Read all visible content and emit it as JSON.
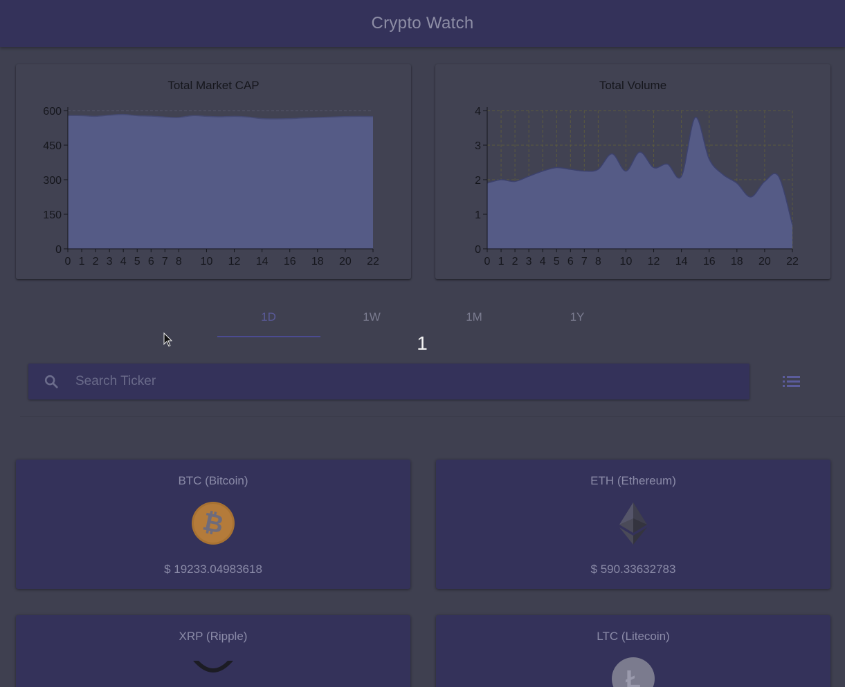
{
  "app": {
    "title": "Crypto Watch"
  },
  "chart_data": [
    {
      "type": "area",
      "title": "Total Market CAP",
      "x": [
        0,
        1,
        2,
        3,
        4,
        5,
        6,
        7,
        8,
        9,
        10,
        11,
        12,
        13,
        14,
        15,
        16,
        17,
        18,
        19,
        20,
        21,
        22
      ],
      "y": [
        578,
        578,
        575,
        580,
        583,
        578,
        576,
        572,
        570,
        578,
        575,
        573,
        575,
        572,
        565,
        564,
        565,
        568,
        570,
        572,
        574,
        575,
        574
      ],
      "xticks": [
        0,
        1,
        2,
        3,
        4,
        5,
        6,
        7,
        8,
        10,
        12,
        14,
        16,
        18,
        20,
        22
      ],
      "yticks": [
        0,
        150,
        300,
        450,
        600
      ],
      "xlim": [
        0,
        22
      ],
      "ylim": [
        0,
        600
      ],
      "grid": false,
      "colors": {
        "fill": "#555b86",
        "line": "#454a72",
        "axis": "#15161c"
      }
    },
    {
      "type": "area",
      "title": "Total Volume",
      "x": [
        0,
        1,
        2,
        3,
        4,
        5,
        6,
        7,
        8,
        9,
        10,
        11,
        12,
        13,
        14,
        15,
        16,
        17,
        18,
        19,
        20,
        21,
        22
      ],
      "y": [
        1.9,
        2.0,
        1.95,
        2.1,
        2.25,
        2.35,
        2.3,
        2.25,
        2.3,
        2.75,
        2.25,
        2.8,
        2.35,
        2.45,
        2.1,
        3.8,
        2.6,
        2.15,
        1.9,
        1.5,
        1.95,
        2.1,
        0.7
      ],
      "xticks": [
        0,
        1,
        2,
        3,
        4,
        5,
        6,
        7,
        8,
        10,
        12,
        14,
        16,
        18,
        20,
        22
      ],
      "yticks": [
        0,
        1,
        2,
        3,
        4
      ],
      "xlim": [
        0,
        22
      ],
      "ylim": [
        0,
        4
      ],
      "grid": true,
      "colors": {
        "fill": "#555b86",
        "line": "#3c416c",
        "grid": "#5c5a3e",
        "axis": "#15161c"
      }
    }
  ],
  "tabs": [
    {
      "label": "1D",
      "active": true
    },
    {
      "label": "1W",
      "active": false
    },
    {
      "label": "1M",
      "active": false
    },
    {
      "label": "1Y",
      "active": false
    }
  ],
  "page_indicator": "1",
  "search": {
    "placeholder": "Search Ticker",
    "value": "",
    "icon": "search-icon"
  },
  "list_toggle": {
    "icon": "list-icon"
  },
  "coins": [
    {
      "name": "BTC (Bitcoin)",
      "price": "$ 19233.04983618",
      "icon": "bitcoin-logo-icon",
      "color": "#b07a3a"
    },
    {
      "name": "ETH (Ethereum)",
      "price": "$ 590.33632783",
      "icon": "ethereum-logo-icon",
      "color": "#3f3f4e"
    },
    {
      "name": "XRP (Ripple)",
      "price": "",
      "icon": "ripple-logo-icon",
      "color": "#1c1c24"
    },
    {
      "name": "LTC (Litecoin)",
      "price": "",
      "icon": "litecoin-logo-icon",
      "color": "#7b7b8e"
    }
  ],
  "colors": {
    "appbar": "#34325a",
    "accent": "#4b4b92",
    "background": "#3f4050"
  }
}
